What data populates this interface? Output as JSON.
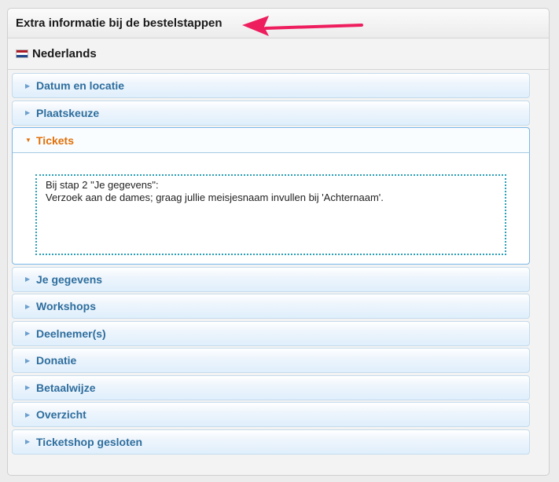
{
  "panel": {
    "title": "Extra informatie bij de bestelstappen"
  },
  "language": {
    "label": "Nederlands",
    "flag_colors": [
      "#ae1c28",
      "#ffffff",
      "#21468b"
    ]
  },
  "accordion": {
    "before_open": [
      {
        "label": "Datum en locatie"
      },
      {
        "label": "Plaatskeuze"
      }
    ],
    "open": {
      "label": "Tickets",
      "content_line1": "Bij stap 2 \"Je gegevens\":",
      "content_line2": "Verzoek aan de dames; graag jullie meisjesnaam invullen bij 'Achternaam'."
    },
    "after_open": [
      {
        "label": "Je gegevens"
      },
      {
        "label": "Workshops"
      },
      {
        "label": "Deelnemer(s)"
      },
      {
        "label": "Donatie"
      },
      {
        "label": "Betaalwijze"
      },
      {
        "label": "Overzicht"
      },
      {
        "label": "Ticketshop gesloten"
      }
    ]
  },
  "colors": {
    "accent_open": "#e17009",
    "header_text": "#2e6e9e",
    "annotation_arrow": "#ee1e5e"
  }
}
